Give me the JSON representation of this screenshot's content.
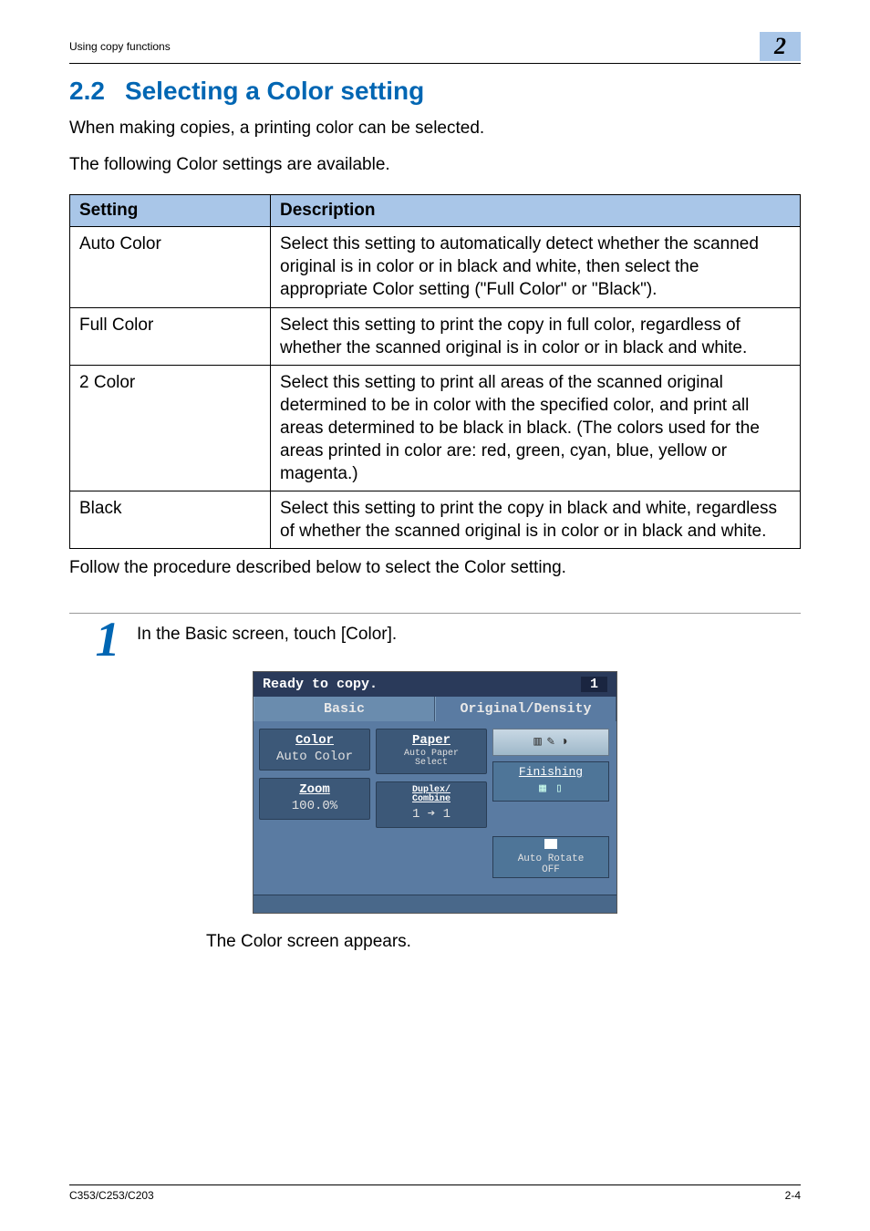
{
  "header": {
    "title": "Using copy functions",
    "chapter": "2"
  },
  "section": {
    "number": "2.2",
    "title": "Selecting a Color setting"
  },
  "intro": {
    "p1": "When making copies, a printing color can be selected.",
    "p2": "The following Color settings are available."
  },
  "table": {
    "headers": {
      "col1": "Setting",
      "col2": "Description"
    },
    "rows": {
      "r1c1": "Auto Color",
      "r1c2": "Select this setting to automatically detect whether the scanned original is in color or in black and white, then select the appropriate Color setting (\"Full Color\" or \"Black\").",
      "r2c1": "Full Color",
      "r2c2": "Select this setting to print the copy in full color, regardless of whether the scanned original is in color or in black and white.",
      "r3c1": "2 Color",
      "r3c2": "Select this setting to print all areas of the scanned original determined to be in color with the specified color, and print all areas determined to be black in black. (The colors used for the areas printed in color are: red, green, cyan, blue, yellow or magenta.)",
      "r4c1": "Black",
      "r4c2": "Select this setting to print the copy in black and white, regardless of whether the scanned original is in color or in black and white."
    }
  },
  "procedure": {
    "follow": "Follow the procedure described below to select the Color setting.",
    "step1_num": "1",
    "step1_text": "In the Basic screen, touch [Color].",
    "step1_result": "The Color screen appears."
  },
  "device": {
    "status": "Ready to copy.",
    "counter": "1",
    "tabs": {
      "basic": "Basic",
      "original": "Original/Density"
    },
    "cards": {
      "color": {
        "title": "Color",
        "value": "Auto Color"
      },
      "paper": {
        "title": "Paper",
        "line1": "Auto Paper",
        "line2": "Select"
      },
      "zoom": {
        "title": "Zoom",
        "value": "100.0%"
      },
      "duplex": {
        "title1": "Duplex/",
        "title2": "Combine",
        "value": "1 ➔ 1"
      },
      "finishing": {
        "title": "Finishing"
      },
      "rotate": {
        "line1": "Auto",
        "line2": "OFF",
        "label": "Rotate"
      }
    }
  },
  "footer": {
    "left": "C353/C253/C203",
    "right": "2-4"
  }
}
